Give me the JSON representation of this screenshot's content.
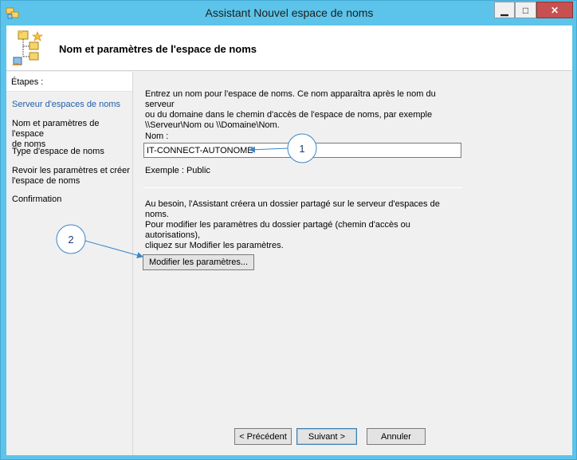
{
  "window": {
    "title": "Assistant Nouvel espace de noms",
    "minimize_glyph": "▁",
    "maximize_glyph": "□",
    "close_glyph": "✕"
  },
  "header": {
    "title": "Nom et paramètres de l'espace de noms",
    "icon": "namespace-tree-icon"
  },
  "sidebar": {
    "heading": "Étapes :",
    "steps": [
      {
        "line1": "Serveur d'espaces de noms",
        "line2": ""
      },
      {
        "line1": "Nom et paramètres de l'espace",
        "line2": "de noms"
      },
      {
        "line1": "Type d'espace de noms",
        "line2": ""
      },
      {
        "line1": "Revoir les paramètres et créer",
        "line2": "l'espace de noms"
      },
      {
        "line1": "Confirmation",
        "line2": ""
      }
    ]
  },
  "main": {
    "intro": {
      "line1": "Entrez un nom pour l'espace de noms. Ce nom apparaîtra après le nom du serveur",
      "line2": "ou du domaine dans le chemin d'accès de l'espace de noms, par exemple",
      "line3": "\\\\Serveur\\Nom ou \\\\Domaine\\Nom."
    },
    "name_label": "Nom :",
    "name_value": "IT-CONNECT-AUTONOME",
    "example": "Exemple : Public",
    "info": {
      "line1": "Au besoin, l'Assistant créera un dossier partagé sur le serveur d'espaces de noms.",
      "line2": "Pour modifier les paramètres du dossier partagé (chemin d'accès ou autorisations),",
      "line3": "cliquez sur Modifier les paramètres."
    },
    "modify_button": "Modifier les paramètres..."
  },
  "footer": {
    "previous": "< Précédent",
    "next": "Suivant >",
    "cancel": "Annuler"
  },
  "annotations": {
    "callout_1": "1",
    "callout_2": "2",
    "color": "#3a87c8"
  },
  "colors": {
    "title_bar": "#5cc4ea",
    "active_step": "#1f5fa6",
    "close_button": "#c75050"
  }
}
